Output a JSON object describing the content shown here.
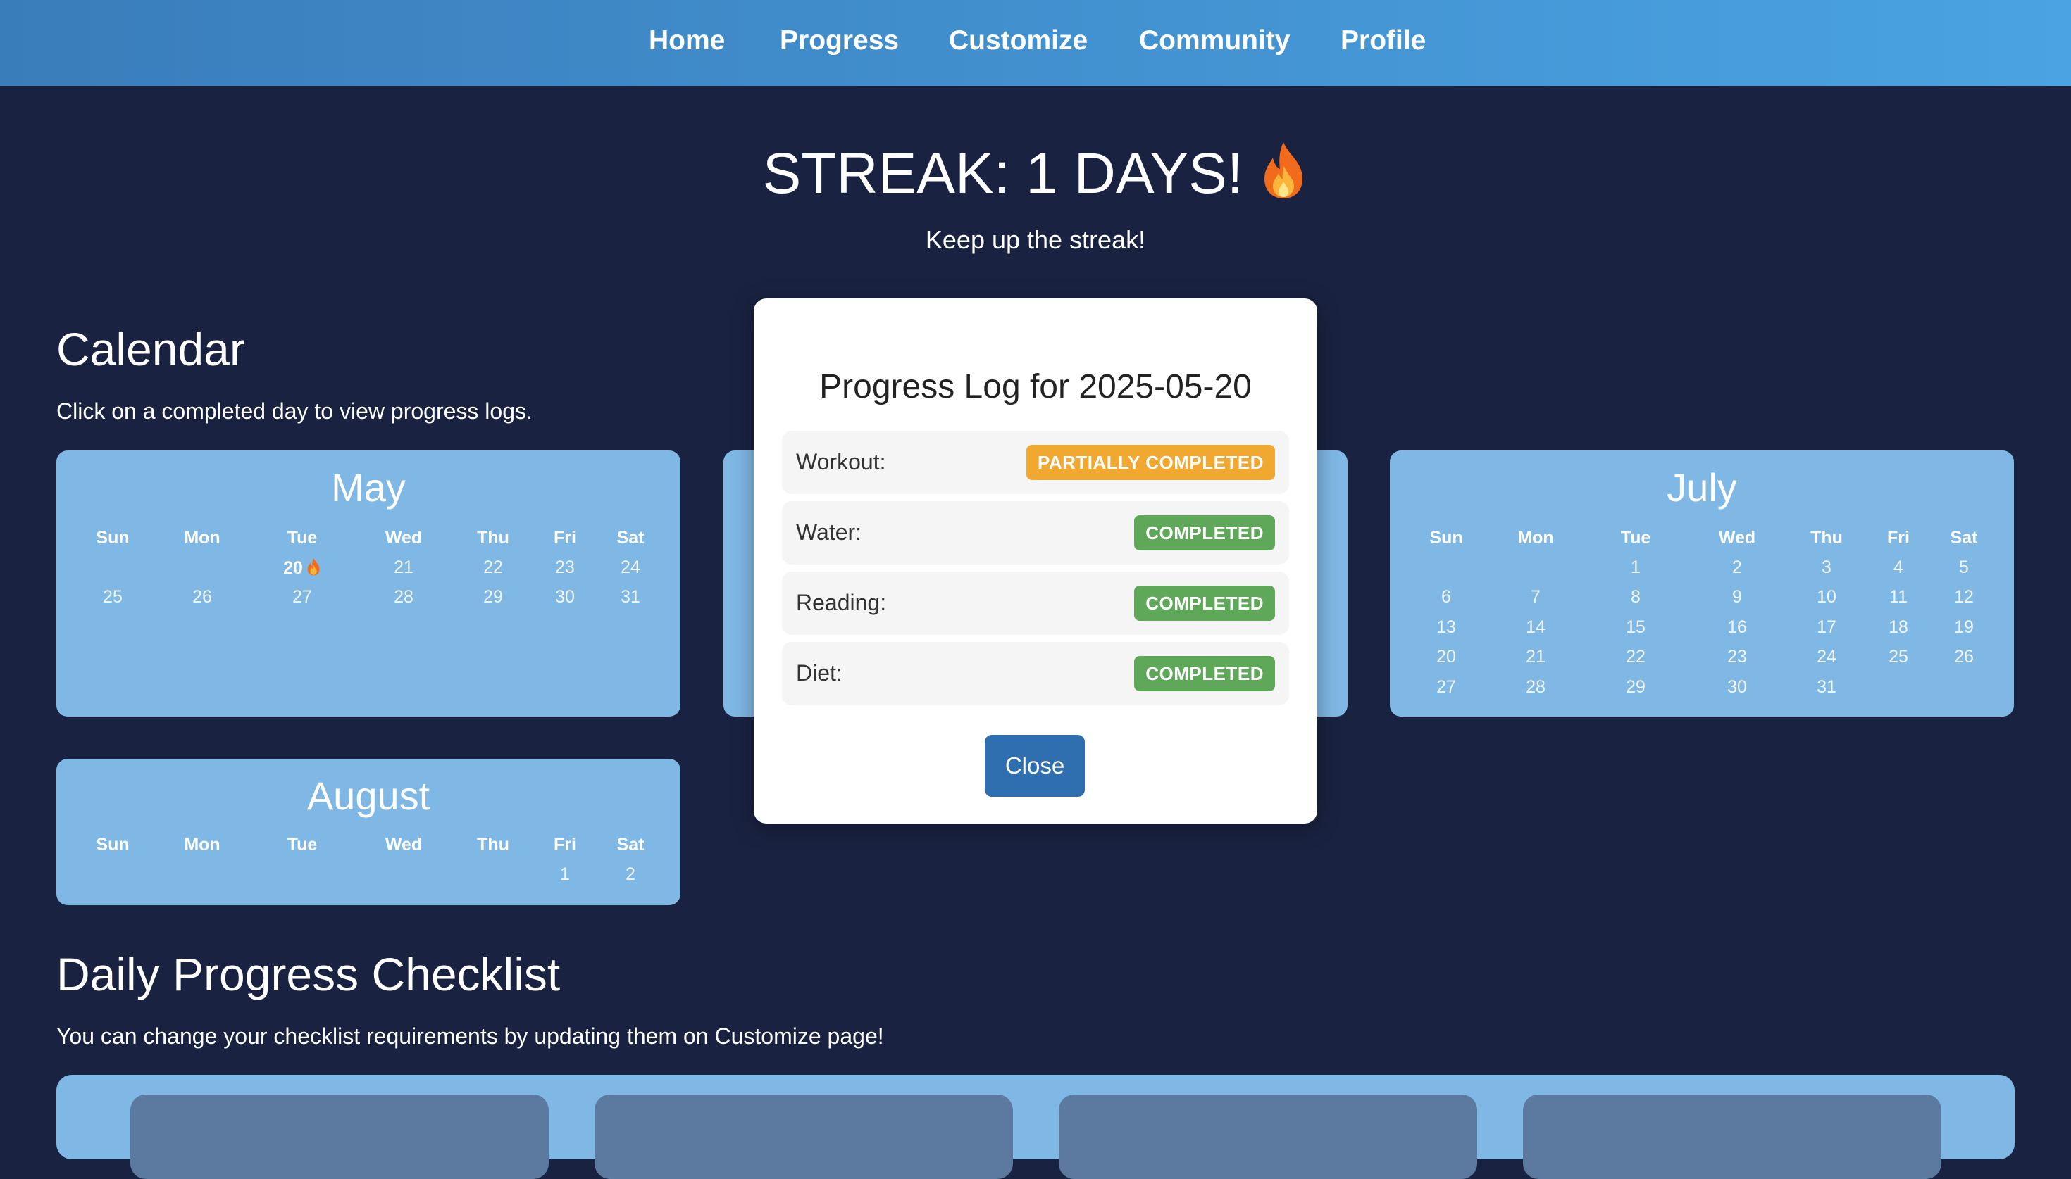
{
  "nav": {
    "items": [
      {
        "label": "Home"
      },
      {
        "label": "Progress"
      },
      {
        "label": "Customize"
      },
      {
        "label": "Community"
      },
      {
        "label": "Profile"
      }
    ]
  },
  "streak": {
    "title": "STREAK: 1 DAYS!",
    "subtitle": "Keep up the streak!"
  },
  "calendar": {
    "title": "Calendar",
    "subtitle": "Click on a completed day to view progress logs.",
    "weekday_labels": [
      "Sun",
      "Mon",
      "Tue",
      "Wed",
      "Thu",
      "Fri",
      "Sat"
    ],
    "months": [
      {
        "name": "May",
        "weeks": [
          [
            "",
            "",
            "20",
            "21",
            "22",
            "23",
            "24"
          ],
          [
            "25",
            "26",
            "27",
            "28",
            "29",
            "30",
            "31"
          ]
        ],
        "completed_day": "20"
      },
      {
        "name": "July",
        "weeks": [
          [
            "",
            "",
            "1",
            "2",
            "3",
            "4",
            "5"
          ],
          [
            "6",
            "7",
            "8",
            "9",
            "10",
            "11",
            "12"
          ],
          [
            "13",
            "14",
            "15",
            "16",
            "17",
            "18",
            "19"
          ],
          [
            "20",
            "21",
            "22",
            "23",
            "24",
            "25",
            "26"
          ],
          [
            "27",
            "28",
            "29",
            "30",
            "31",
            "",
            ""
          ]
        ]
      },
      {
        "name": "August",
        "weeks": [
          [
            "",
            "",
            "",
            "",
            "",
            "1",
            "2"
          ]
        ]
      }
    ]
  },
  "checklist": {
    "title": "Daily Progress Checklist",
    "subtitle": "You can change your checklist requirements by updating them on Customize page!"
  },
  "modal": {
    "title": "Progress Log for 2025-05-20",
    "items": [
      {
        "label": "Workout:",
        "status": "PARTIALLY COMPLETED",
        "color": "#f0a830"
      },
      {
        "label": "Water:",
        "status": "COMPLETED",
        "color": "#5fa85a"
      },
      {
        "label": "Reading:",
        "status": "COMPLETED",
        "color": "#5fa85a"
      },
      {
        "label": "Diet:",
        "status": "COMPLETED",
        "color": "#5fa85a"
      }
    ],
    "close_label": "Close"
  },
  "colors": {
    "background": "#192240",
    "nav_start": "#3a7dbb",
    "nav_end": "#4aa3e2",
    "card": "#7fb8e4",
    "primary_button": "#2f6fb0"
  },
  "icons": {
    "streak": "fire-icon",
    "completed_day": "fire-icon"
  }
}
